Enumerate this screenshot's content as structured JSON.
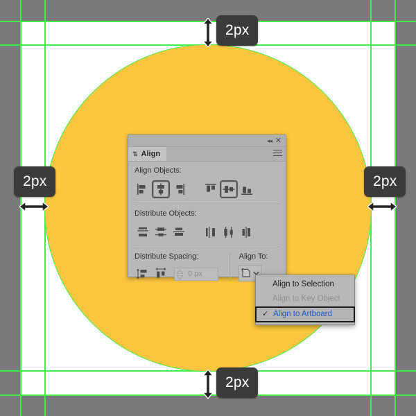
{
  "app": {
    "canvas_color": "#7a7a7a",
    "artboard_color": "#ffffff",
    "guide_color": "#45ed4a"
  },
  "shape": {
    "name": "ellipse",
    "fill_color": "#fcc73f",
    "outline_color": "#45ed4a"
  },
  "measurements": [
    {
      "id": "top",
      "value": "2px",
      "direction": "vertical"
    },
    {
      "id": "left",
      "value": "2px",
      "direction": "horizontal"
    },
    {
      "id": "right",
      "value": "2px",
      "direction": "horizontal"
    },
    {
      "id": "bottom",
      "value": "2px",
      "direction": "vertical"
    }
  ],
  "panel": {
    "title": "Align",
    "collapse_icon": "◂◂",
    "close_icon": "✕",
    "sort_icon": "⇅",
    "menu_icon": "hamburger-icon",
    "sections": {
      "align_objects": {
        "label": "Align Objects:",
        "buttons": [
          {
            "name": "horizontal-align-left",
            "active": false
          },
          {
            "name": "horizontal-align-center",
            "active": true
          },
          {
            "name": "horizontal-align-right",
            "active": false
          },
          {
            "name": "vertical-align-top",
            "active": false
          },
          {
            "name": "vertical-align-center",
            "active": true
          },
          {
            "name": "vertical-align-bottom",
            "active": false
          }
        ]
      },
      "distribute_objects": {
        "label": "Distribute Objects:",
        "buttons": [
          {
            "name": "vertical-distribute-top",
            "active": false
          },
          {
            "name": "vertical-distribute-center",
            "active": false
          },
          {
            "name": "vertical-distribute-bottom",
            "active": false
          },
          {
            "name": "horizontal-distribute-left",
            "active": false
          },
          {
            "name": "horizontal-distribute-center",
            "active": false
          },
          {
            "name": "horizontal-distribute-right",
            "active": false
          }
        ]
      },
      "distribute_spacing": {
        "label": "Distribute Spacing:",
        "buttons": [
          {
            "name": "vertical-distribute-space",
            "active": false
          },
          {
            "name": "horizontal-distribute-space",
            "active": false
          }
        ],
        "input_value": "0 px",
        "input_enabled": false
      },
      "align_to": {
        "label": "Align To:",
        "selected_icon": "align-to-artboard-icon",
        "chevron": "⌄"
      }
    }
  },
  "dropdown": {
    "items": [
      {
        "label": "Align to Selection",
        "state": "normal",
        "checked": false
      },
      {
        "label": "Align to Key Object",
        "state": "disabled",
        "checked": false
      },
      {
        "label": "Align to Artboard",
        "state": "selected",
        "checked": true
      }
    ],
    "check_glyph": "✓",
    "selected_text_color": "#1f58c9"
  }
}
